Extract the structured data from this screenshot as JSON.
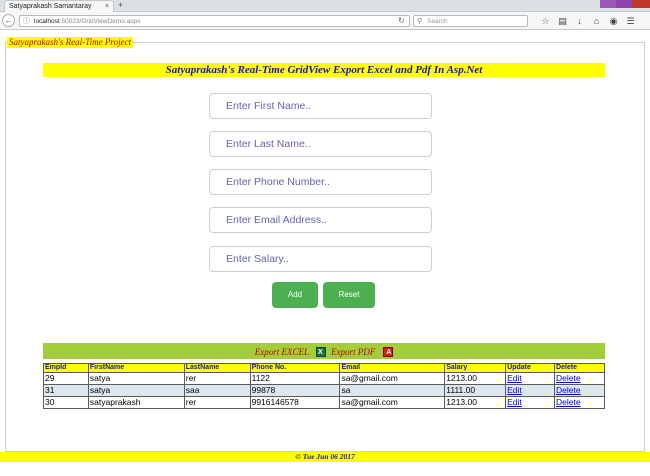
{
  "browser": {
    "tab_title": "Satyaprakash Samantaray",
    "tab_close": "×",
    "new_tab": "+",
    "url_host": "localhost",
    "url_rest": ":50023/GridViewDemo.aspx",
    "search_placeholder": "Search",
    "accent_colors": [
      "#9b59b6",
      "#8e44ad",
      "#c0392b"
    ]
  },
  "page": {
    "legend": "Satyaprakash's Real-Time Project",
    "banner": "Satyaprakash's Real-Time GridView Export Excel and Pdf In Asp.Net",
    "form": {
      "first_name_placeholder": "Enter First Name..",
      "last_name_placeholder": "Enter Last Name..",
      "phone_placeholder": "Enter Phone Number..",
      "email_placeholder": "Enter Email Address..",
      "salary_placeholder": "Enter Salary.."
    },
    "buttons": {
      "add": "Add",
      "reset": "Reset"
    },
    "export": {
      "excel": "Export EXCEL",
      "pdf": "Export PDF"
    },
    "grid": {
      "headers": [
        "EmpId",
        "FirstName",
        "LastName",
        "Phone No.",
        "Email",
        "Salary",
        "Update",
        "Delete"
      ],
      "rows": [
        [
          "29",
          "satya",
          "rer",
          "1122",
          "sa@gmail.com",
          "1213.00",
          "Edit",
          "Delete"
        ],
        [
          "31",
          "satya",
          "saa",
          "99878",
          "sa",
          "1111.00",
          "Edit",
          "Delete"
        ],
        [
          "30",
          "satyaprakash",
          "rer",
          "9916146578",
          "sa@gmail.com",
          "1213.00",
          "Edit",
          "Delete"
        ]
      ]
    },
    "footer": "© Tue Jun 06 2017"
  },
  "colors": {
    "banner_bg": "#ffff00",
    "banner_text": "#1a1aa6",
    "legend_text": "#c00000",
    "button_bg": "#4caf50",
    "export_bar_bg": "#a4cd3a",
    "grid_alt_row": "#dfe7ee"
  }
}
